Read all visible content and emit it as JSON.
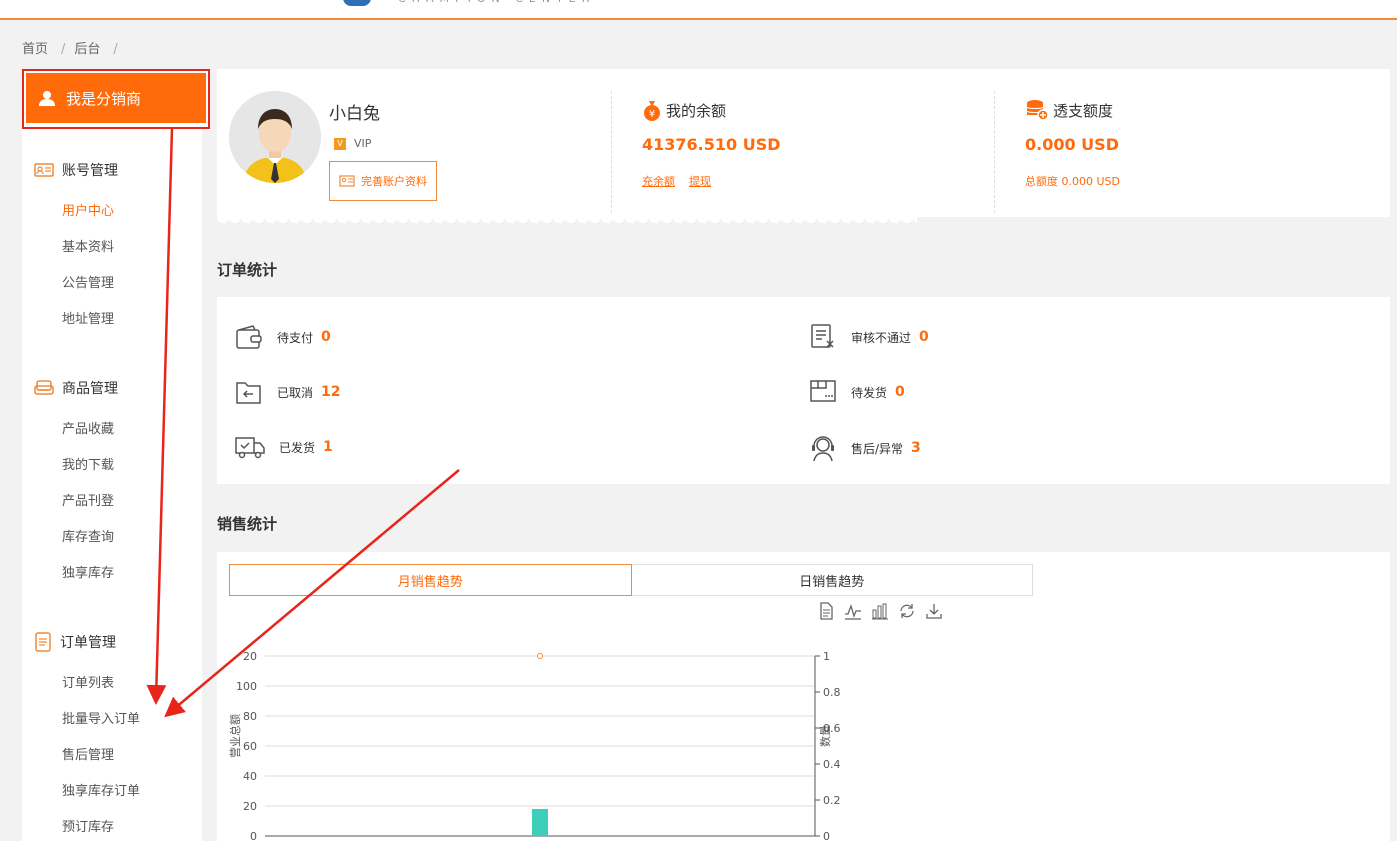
{
  "breadcrumb": {
    "home": "首页",
    "section": "后台",
    "sep1": "/",
    "sep2": "/"
  },
  "sidebar": {
    "header_label": "我是分销商",
    "groups": [
      {
        "title": "账号管理",
        "items": [
          "用户中心",
          "基本资料",
          "公告管理",
          "地址管理"
        ]
      },
      {
        "title": "商品管理",
        "items": [
          "产品收藏",
          "我的下载",
          "产品刊登",
          "库存查询",
          "独享库存"
        ]
      },
      {
        "title": "订单管理",
        "items": [
          "订单列表",
          "批量导入订单",
          "售后管理",
          "独享库存订单",
          "预订库存"
        ]
      }
    ],
    "active_item": "用户中心"
  },
  "profile": {
    "username": "小白兔",
    "level": "VIP",
    "complete_button": "完善账户资料",
    "balance": {
      "title": "我的余额",
      "value": "41376.510 USD",
      "links": [
        "充余额",
        "提现"
      ]
    },
    "overdraft": {
      "title": "透支额度",
      "value": "0.000 USD",
      "total": "总额度 0.000 USD"
    }
  },
  "orders": {
    "title": "订单统计",
    "items": [
      {
        "label": "待支付",
        "count": "0",
        "icon": "wallet-icon"
      },
      {
        "label": "审核不通过",
        "count": "0",
        "icon": "rejected-doc-icon"
      },
      {
        "label": "已取消",
        "count": "12",
        "icon": "cancelled-folder-icon"
      },
      {
        "label": "待发货",
        "count": "0",
        "icon": "pending-box-icon"
      },
      {
        "label": "已发货",
        "count": "1",
        "icon": "truck-icon"
      },
      {
        "label": "售后/异常",
        "count": "3",
        "icon": "support-agent-icon"
      }
    ]
  },
  "sales": {
    "title": "销售统计",
    "tabs": [
      "月销售趋势",
      "日销售趋势"
    ],
    "active_tab": "月销售趋势",
    "tools": [
      "data-view-icon",
      "line-chart-icon",
      "bar-chart-icon",
      "refresh-icon",
      "download-icon"
    ]
  },
  "chart_data": {
    "type": "bar",
    "title": "",
    "ylabel": "营业总额",
    "y2label": "数量",
    "ylim": [
      0,
      120
    ],
    "y2lim": [
      0,
      1
    ],
    "yticks": [
      "20",
      "100",
      "80",
      "60",
      "40",
      "20",
      "0"
    ],
    "y2ticks": [
      "1",
      "0.8",
      "0.6",
      "0.4",
      "0.2",
      "0"
    ],
    "series": [
      {
        "type": "bar",
        "values": [
          18
        ],
        "color": "#3ecfba"
      },
      {
        "type": "line",
        "values": [
          1
        ],
        "color": "#f08a3a"
      }
    ],
    "grid": true
  },
  "colors": {
    "accent": "#ff6a0a",
    "highlight": "#e8251b",
    "bar": "#3ecfba"
  }
}
